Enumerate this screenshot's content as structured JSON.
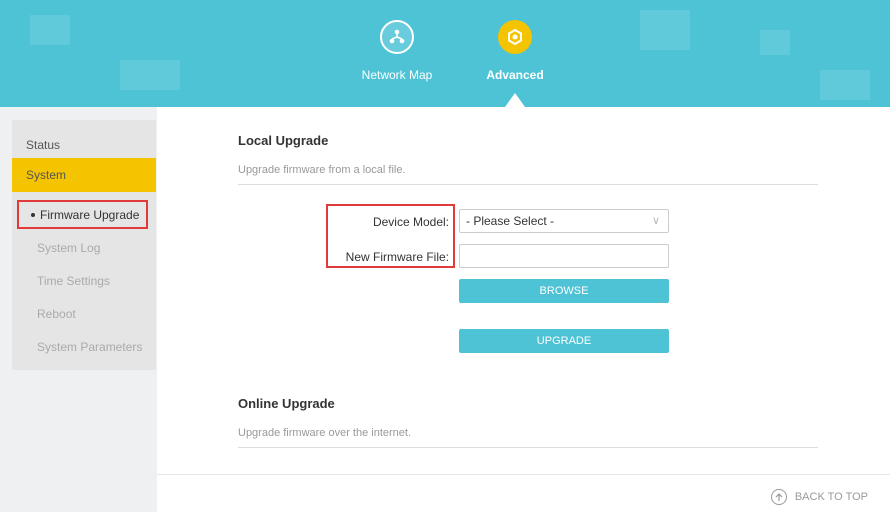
{
  "header": {
    "nav": [
      {
        "label": "Network Map",
        "icon": "network-map-icon"
      },
      {
        "label": "Advanced",
        "icon": "advanced-gear-icon",
        "active": true
      }
    ],
    "colors": {
      "header_bg": "#4fc3d6",
      "active_accent": "#f5c400"
    }
  },
  "sidebar": {
    "status": "Status",
    "system": "System",
    "items": [
      {
        "label": "Firmware Upgrade",
        "active": true
      },
      {
        "label": "System Log"
      },
      {
        "label": "Time Settings"
      },
      {
        "label": "Reboot"
      },
      {
        "label": "System Parameters"
      }
    ]
  },
  "local_upgrade": {
    "title": "Local Upgrade",
    "description": "Upgrade firmware from a local file.",
    "device_model_label": "Device Model:",
    "device_model_value": "- Please Select -",
    "firmware_file_label": "New Firmware File:",
    "firmware_file_value": "",
    "browse_label": "BROWSE",
    "upgrade_label": "UPGRADE"
  },
  "online_upgrade": {
    "title": "Online Upgrade",
    "description": "Upgrade firmware over the internet."
  },
  "footer": {
    "back_to_top": "BACK TO TOP"
  }
}
